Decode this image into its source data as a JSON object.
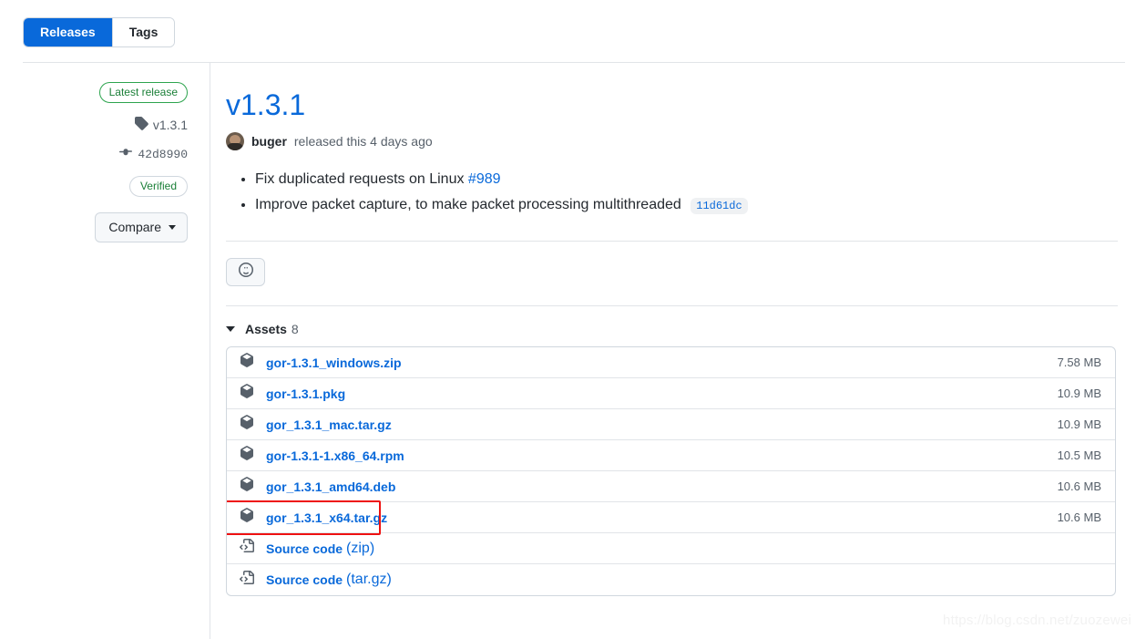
{
  "tabs": [
    {
      "label": "Releases",
      "active": true
    },
    {
      "label": "Tags",
      "active": false
    }
  ],
  "sidebar": {
    "latest_badge": "Latest release",
    "tag": "v1.3.1",
    "commit": "42d8990",
    "verified_badge": "Verified",
    "compare_label": "Compare"
  },
  "release": {
    "title": "v1.3.1",
    "author": "buger",
    "published_text": "released this 4 days ago",
    "notes": [
      {
        "text": "Fix duplicated requests on Linux",
        "issue": "#989",
        "commit": ""
      },
      {
        "text": "Improve packet capture, to make packet processing multithreaded",
        "issue": "",
        "commit": "11d61dc"
      }
    ]
  },
  "assets": {
    "header_label": "Assets",
    "count": "8",
    "rows": [
      {
        "name": "gor-1.3.1_windows.zip",
        "ext": "",
        "size": "7.58 MB",
        "icon": "package-icon",
        "highlighted": false
      },
      {
        "name": "gor-1.3.1.pkg",
        "ext": "",
        "size": "10.9 MB",
        "icon": "package-icon",
        "highlighted": false
      },
      {
        "name": "gor_1.3.1_mac.tar.gz",
        "ext": "",
        "size": "10.9 MB",
        "icon": "package-icon",
        "highlighted": false
      },
      {
        "name": "gor-1.3.1-1.x86_64.rpm",
        "ext": "",
        "size": "10.5 MB",
        "icon": "package-icon",
        "highlighted": false
      },
      {
        "name": "gor_1.3.1_amd64.deb",
        "ext": "",
        "size": "10.6 MB",
        "icon": "package-icon",
        "highlighted": false
      },
      {
        "name": "gor_1.3.1_x64.tar.gz",
        "ext": "",
        "size": "10.6 MB",
        "icon": "package-icon",
        "highlighted": true
      },
      {
        "name": "Source code",
        "ext": "(zip)",
        "size": "",
        "icon": "file-code-icon",
        "highlighted": false
      },
      {
        "name": "Source code",
        "ext": "(tar.gz)",
        "size": "",
        "icon": "file-code-icon",
        "highlighted": false
      }
    ]
  },
  "watermark": "https://blog.csdn.net/zuozewei",
  "colors": {
    "accent_blue": "#0969da",
    "green": "#1a7f37",
    "highlight_red": "#ee1111",
    "border": "#d0d7de"
  }
}
